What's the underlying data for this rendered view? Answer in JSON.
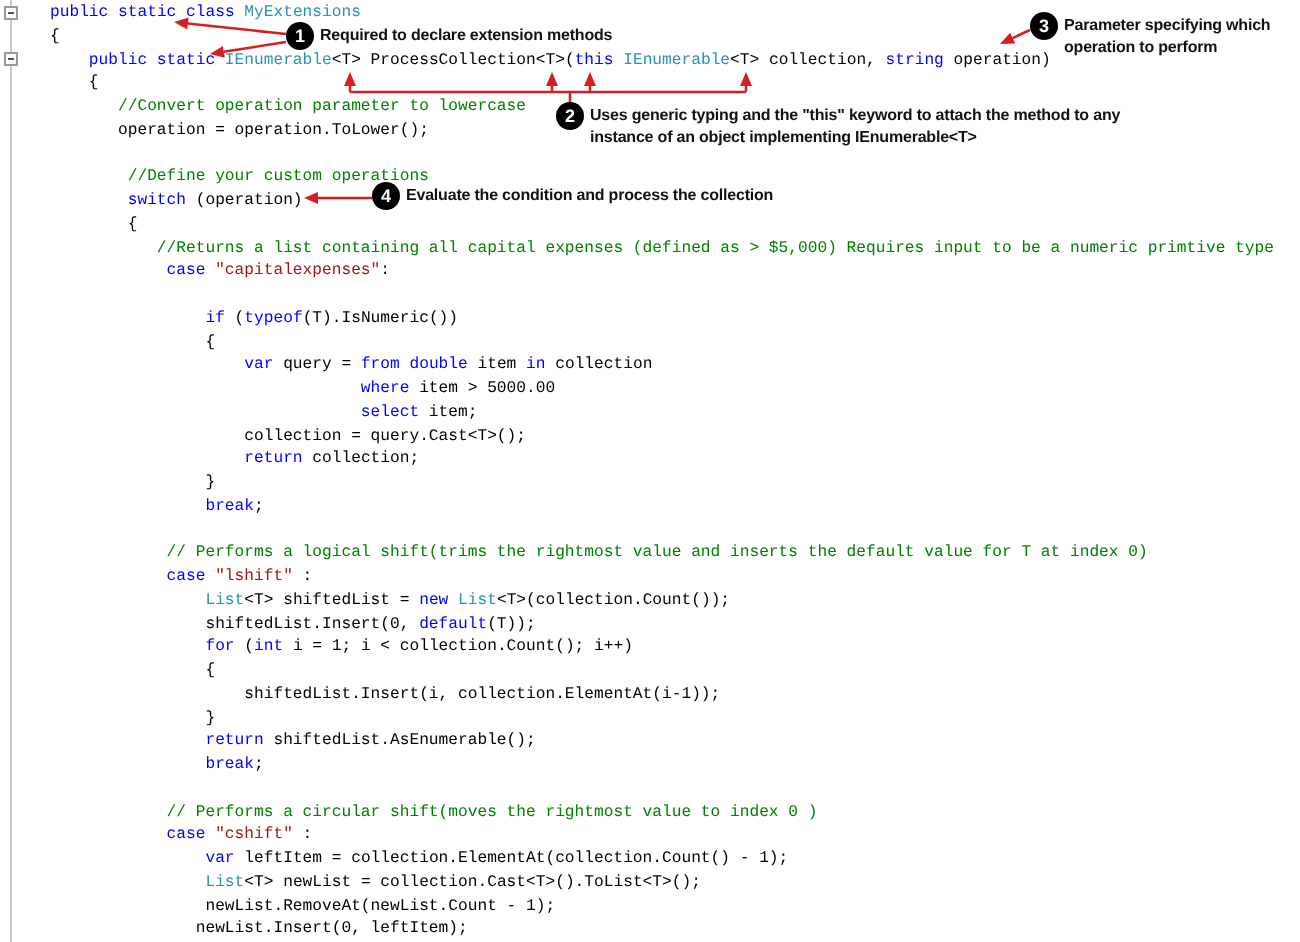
{
  "code_lines": [
    {
      "kind": "code",
      "tokens": [
        {
          "kind": "keyword",
          "text": "public"
        },
        {
          "kind": "keyword",
          "text": " static"
        },
        {
          "kind": "keyword",
          "text": " class"
        },
        {
          "kind": "type",
          "text": " MyExtensions"
        }
      ]
    },
    {
      "kind": "code",
      "tokens": [
        {
          "kind": "plain",
          "text": "{"
        }
      ]
    },
    {
      "kind": "code",
      "tokens": [
        {
          "kind": "keyword",
          "text": "    public"
        },
        {
          "kind": "keyword",
          "text": " static"
        },
        {
          "kind": "type",
          "text": " IEnumerable"
        },
        {
          "kind": "plain",
          "text": "<T> ProcessCollection<T>("
        },
        {
          "kind": "keyword",
          "text": "this"
        },
        {
          "kind": "type",
          "text": " IEnumerable"
        },
        {
          "kind": "plain",
          "text": "<T> collection, "
        },
        {
          "kind": "keyword",
          "text": "string"
        },
        {
          "kind": "plain",
          "text": " operation)"
        }
      ]
    },
    {
      "kind": "code",
      "tokens": [
        {
          "kind": "plain",
          "text": "    {"
        }
      ]
    },
    {
      "kind": "code",
      "tokens": [
        {
          "kind": "comment",
          "text": "       //Convert operation parameter to lowercase"
        }
      ]
    },
    {
      "kind": "code",
      "tokens": [
        {
          "kind": "plain",
          "text": "       operation = operation.ToLower();"
        }
      ]
    },
    {
      "kind": "blank"
    },
    {
      "kind": "code",
      "tokens": [
        {
          "kind": "comment",
          "text": "        //Define your custom operations"
        }
      ]
    },
    {
      "kind": "code",
      "tokens": [
        {
          "kind": "keyword",
          "text": "        switch"
        },
        {
          "kind": "plain",
          "text": " (operation)"
        }
      ]
    },
    {
      "kind": "code",
      "tokens": [
        {
          "kind": "plain",
          "text": "        {"
        }
      ]
    },
    {
      "kind": "code",
      "tokens": [
        {
          "kind": "comment",
          "text": "           //Returns a list containing all capital expenses (defined as > $5,000) Requires input to be a numeric primtive type"
        }
      ]
    },
    {
      "kind": "code",
      "tokens": [
        {
          "kind": "keyword",
          "text": "            case"
        },
        {
          "kind": "string",
          "text": " \"capitalexpenses\""
        },
        {
          "kind": "plain",
          "text": ":"
        }
      ]
    },
    {
      "kind": "blank"
    },
    {
      "kind": "code",
      "tokens": [
        {
          "kind": "keyword",
          "text": "                if"
        },
        {
          "kind": "plain",
          "text": " ("
        },
        {
          "kind": "keyword",
          "text": "typeof"
        },
        {
          "kind": "plain",
          "text": "(T).IsNumeric())"
        }
      ]
    },
    {
      "kind": "code",
      "tokens": [
        {
          "kind": "plain",
          "text": "                {"
        }
      ]
    },
    {
      "kind": "code",
      "tokens": [
        {
          "kind": "keyword",
          "text": "                    var"
        },
        {
          "kind": "plain",
          "text": " query = "
        },
        {
          "kind": "keyword",
          "text": "from"
        },
        {
          "kind": "keyword",
          "text": " double"
        },
        {
          "kind": "plain",
          "text": " item "
        },
        {
          "kind": "keyword",
          "text": "in"
        },
        {
          "kind": "plain",
          "text": " collection"
        }
      ]
    },
    {
      "kind": "code",
      "tokens": [
        {
          "kind": "keyword",
          "text": "                                where"
        },
        {
          "kind": "plain",
          "text": " item > 5000.00"
        }
      ]
    },
    {
      "kind": "code",
      "tokens": [
        {
          "kind": "keyword",
          "text": "                                select"
        },
        {
          "kind": "plain",
          "text": " item;"
        }
      ]
    },
    {
      "kind": "code",
      "tokens": [
        {
          "kind": "plain",
          "text": "                    collection = query.Cast<T>();"
        }
      ]
    },
    {
      "kind": "code",
      "tokens": [
        {
          "kind": "keyword",
          "text": "                    return"
        },
        {
          "kind": "plain",
          "text": " collection;"
        }
      ]
    },
    {
      "kind": "code",
      "tokens": [
        {
          "kind": "plain",
          "text": "                }"
        }
      ]
    },
    {
      "kind": "code",
      "tokens": [
        {
          "kind": "keyword",
          "text": "                break"
        },
        {
          "kind": "plain",
          "text": ";"
        }
      ]
    },
    {
      "kind": "blank"
    },
    {
      "kind": "code",
      "tokens": [
        {
          "kind": "comment",
          "text": "            // Performs a logical shift(trims the rightmost value and inserts the default value for T at index 0)"
        }
      ]
    },
    {
      "kind": "code",
      "tokens": [
        {
          "kind": "keyword",
          "text": "            case"
        },
        {
          "kind": "string",
          "text": " \"lshift\""
        },
        {
          "kind": "plain",
          "text": " :"
        }
      ]
    },
    {
      "kind": "code",
      "tokens": [
        {
          "kind": "type",
          "text": "                List"
        },
        {
          "kind": "plain",
          "text": "<T> shiftedList = "
        },
        {
          "kind": "keyword",
          "text": "new"
        },
        {
          "kind": "type",
          "text": " List"
        },
        {
          "kind": "plain",
          "text": "<T>(collection.Count());"
        }
      ]
    },
    {
      "kind": "code",
      "tokens": [
        {
          "kind": "plain",
          "text": "                shiftedList.Insert(0, "
        },
        {
          "kind": "keyword",
          "text": "default"
        },
        {
          "kind": "plain",
          "text": "(T));"
        }
      ]
    },
    {
      "kind": "code",
      "tokens": [
        {
          "kind": "keyword",
          "text": "                for"
        },
        {
          "kind": "plain",
          "text": " ("
        },
        {
          "kind": "keyword",
          "text": "int"
        },
        {
          "kind": "plain",
          "text": " i = 1; i < collection.Count(); i++)"
        }
      ]
    },
    {
      "kind": "code",
      "tokens": [
        {
          "kind": "plain",
          "text": "                {"
        }
      ]
    },
    {
      "kind": "code",
      "tokens": [
        {
          "kind": "plain",
          "text": "                    shiftedList.Insert(i, collection.ElementAt(i-1));"
        }
      ]
    },
    {
      "kind": "code",
      "tokens": [
        {
          "kind": "plain",
          "text": "                }"
        }
      ]
    },
    {
      "kind": "code",
      "tokens": [
        {
          "kind": "keyword",
          "text": "                return"
        },
        {
          "kind": "plain",
          "text": " shiftedList.AsEnumerable();"
        }
      ]
    },
    {
      "kind": "code",
      "tokens": [
        {
          "kind": "keyword",
          "text": "                break"
        },
        {
          "kind": "plain",
          "text": ";"
        }
      ]
    },
    {
      "kind": "blank"
    },
    {
      "kind": "code",
      "tokens": [
        {
          "kind": "comment",
          "text": "            // Performs a circular shift(moves the rightmost value to index 0 )"
        }
      ]
    },
    {
      "kind": "code",
      "tokens": [
        {
          "kind": "keyword",
          "text": "            case"
        },
        {
          "kind": "string",
          "text": " \"cshift\""
        },
        {
          "kind": "plain",
          "text": " :"
        }
      ]
    },
    {
      "kind": "code",
      "tokens": [
        {
          "kind": "keyword",
          "text": "                var"
        },
        {
          "kind": "plain",
          "text": " leftItem = collection.ElementAt(collection.Count() - 1);"
        }
      ]
    },
    {
      "kind": "code",
      "tokens": [
        {
          "kind": "type",
          "text": "                List"
        },
        {
          "kind": "plain",
          "text": "<T> newList = collection.Cast<T>().ToList<T>();"
        }
      ]
    },
    {
      "kind": "code",
      "tokens": [
        {
          "kind": "plain",
          "text": "                newList.RemoveAt(newList.Count - 1);"
        }
      ]
    },
    {
      "kind": "code",
      "tokens": [
        {
          "kind": "plain",
          "text": "               newList.Insert(0, leftItem);"
        }
      ]
    }
  ],
  "annotations": [
    {
      "number": "1",
      "lines": [
        "Required to declare extension methods"
      ]
    },
    {
      "number": "2",
      "lines": [
        "Uses generic typing and the \"this\" keyword to attach the method to any",
        "instance of an object implementing IEnumerable<T>"
      ]
    },
    {
      "number": "3",
      "lines": [
        "Parameter specifying which",
        "operation to perform"
      ]
    },
    {
      "number": "4",
      "lines": [
        "Evaluate the condition and process the collection"
      ]
    }
  ]
}
